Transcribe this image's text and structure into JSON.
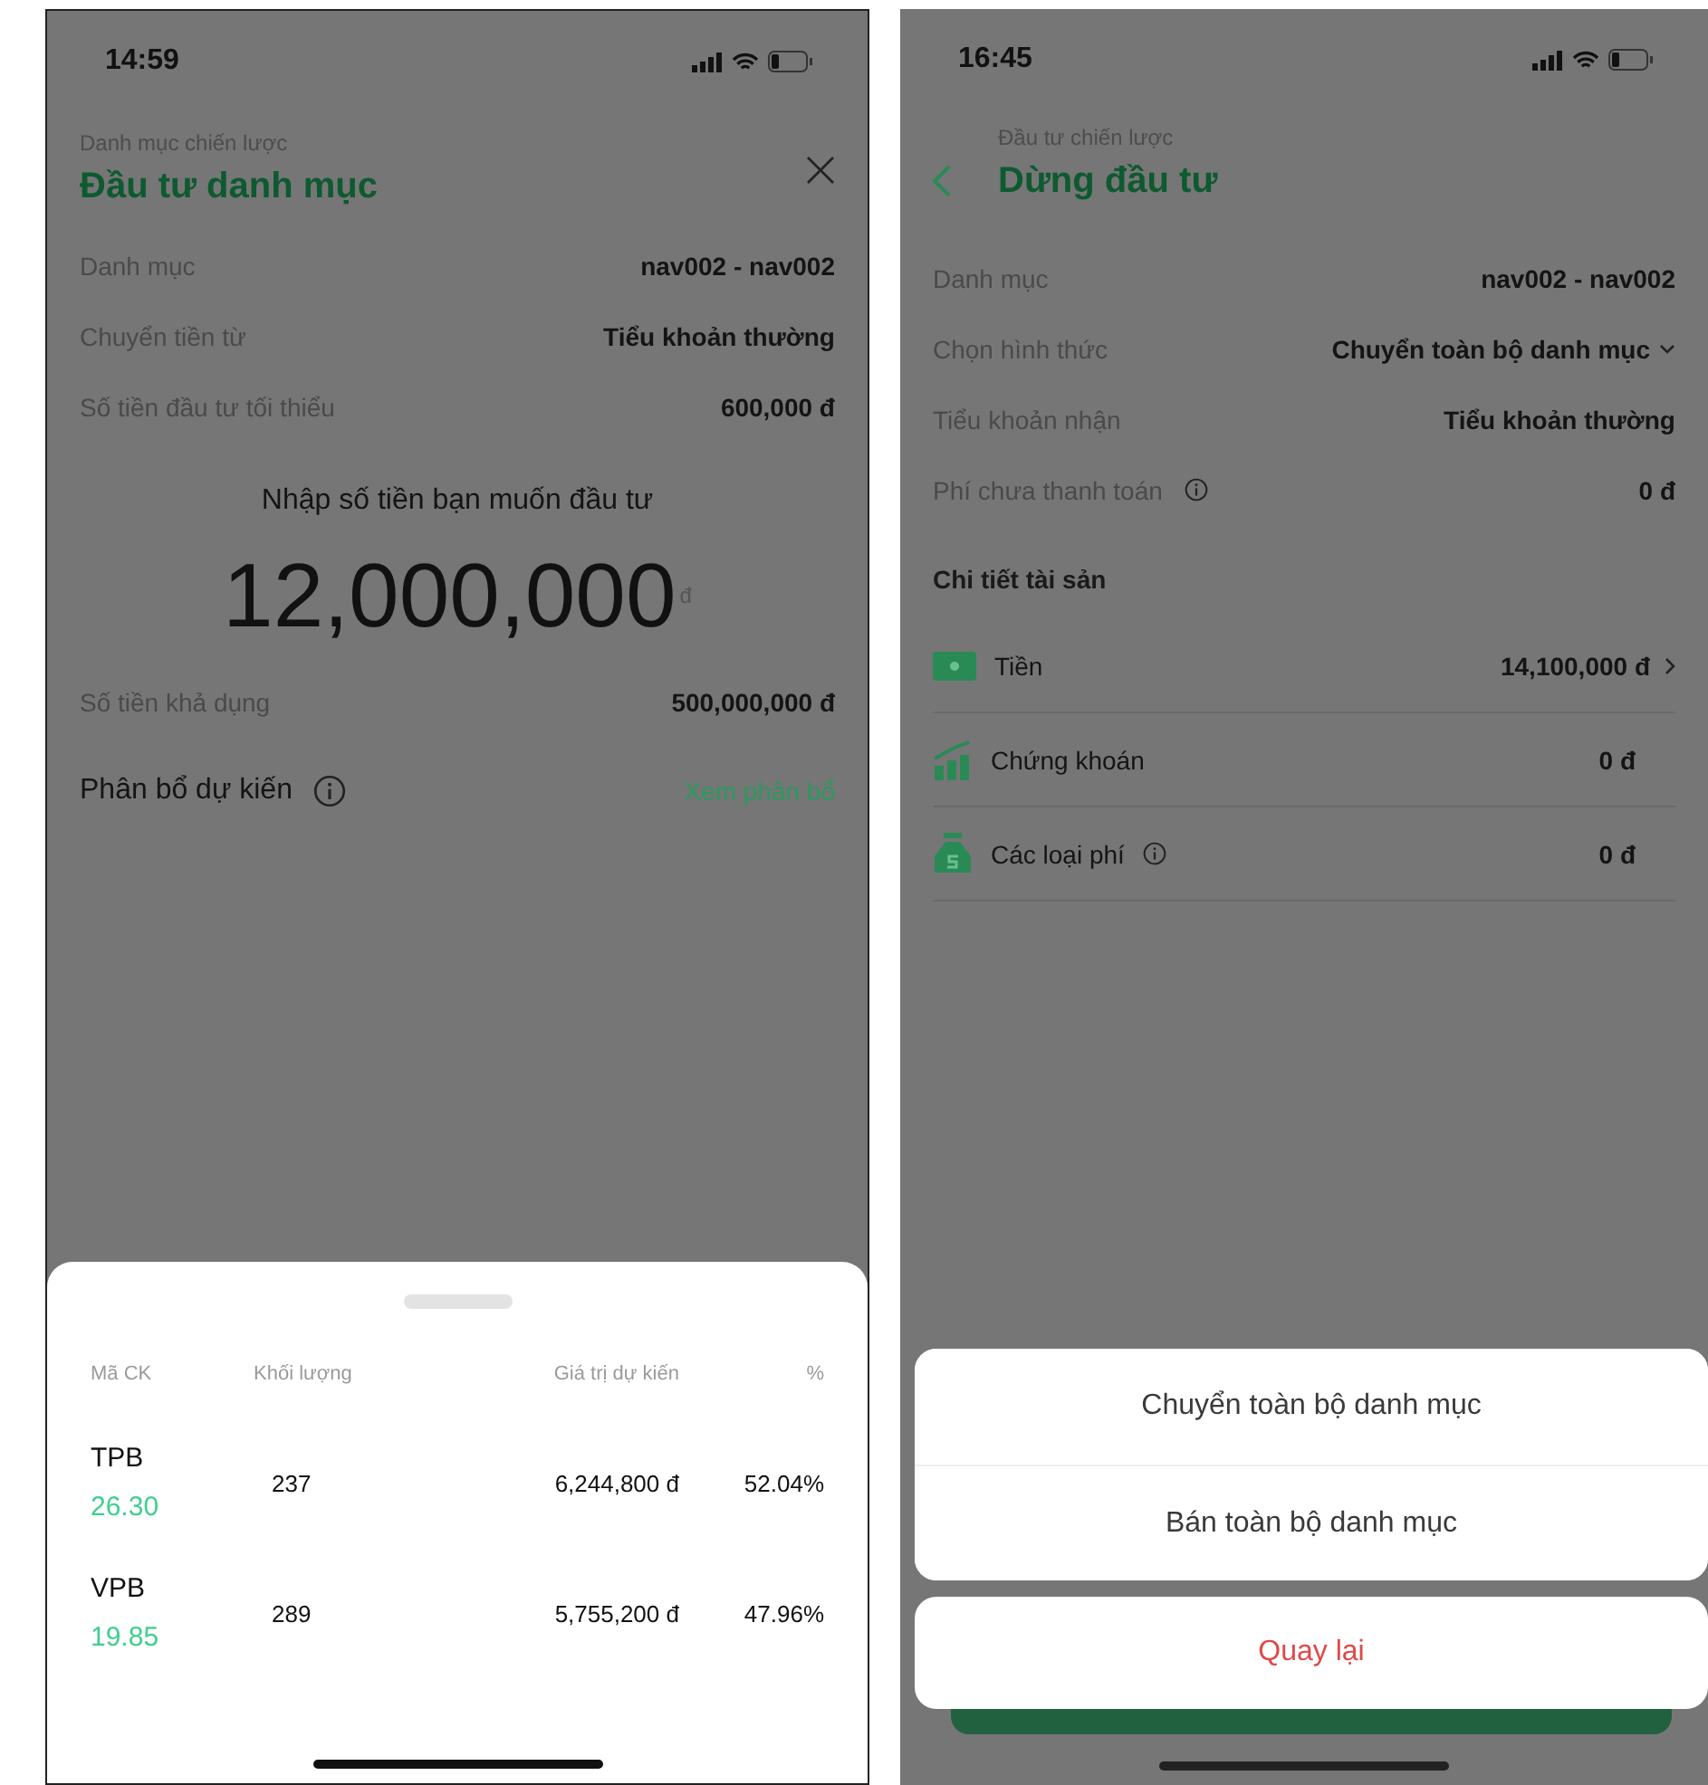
{
  "invest_screen": {
    "status_bar": {
      "time": "14:59"
    },
    "header": {
      "breadcrumb": "Danh mục chiến lược",
      "title": "Đầu tư danh mục"
    },
    "info_rows": [
      {
        "label": "Danh mục",
        "value": "nav002 - nav002"
      },
      {
        "label": "Chuyển tiền từ",
        "value": "Tiểu khoản thường"
      },
      {
        "label": "Số tiền đầu tư tối thiểu",
        "value": "600,000 đ"
      }
    ],
    "amount_prompt": "Nhập số tiền bạn muốn đầu tư",
    "amount": {
      "value": "12,000,000",
      "currency": "đ"
    },
    "available": {
      "label": "Số tiền khả dụng",
      "value": "500,000,000 đ"
    },
    "allocation": {
      "label": "Phân bổ dự kiến",
      "link": "Xem phân bổ"
    },
    "allocation_sheet": {
      "columns": [
        "Mã CK",
        "Khối lượng",
        "Giá trị dự kiến",
        "%"
      ],
      "rows": [
        {
          "code": "TPB",
          "price": "26.30",
          "volume": "237",
          "value": "6,244,800 đ",
          "percent": "52.04%"
        },
        {
          "code": "VPB",
          "price": "19.85",
          "volume": "289",
          "value": "5,755,200 đ",
          "percent": "47.96%"
        }
      ]
    }
  },
  "stop_screen": {
    "status_bar": {
      "time": "16:45"
    },
    "header": {
      "breadcrumb": "Đầu tư chiến lược",
      "title": "Dừng đầu tư"
    },
    "info_rows": [
      {
        "kind": "text",
        "label": "Danh mục",
        "value": "nav002 - nav002"
      },
      {
        "kind": "dropdown",
        "label": "Chọn hình thức",
        "value": "Chuyển toàn bộ danh mục"
      },
      {
        "kind": "text",
        "label": "Tiểu khoản nhận",
        "value": "Tiểu khoản thường"
      },
      {
        "kind": "info",
        "label": "Phí chưa thanh toán",
        "value": "0 đ"
      }
    ],
    "section_title": "Chi tiết tài sản",
    "assets": [
      {
        "kind": "cash",
        "label": "Tiền",
        "value": "14,100,000 đ",
        "info": false,
        "chevron": true
      },
      {
        "kind": "stocks",
        "label": "Chứng khoán",
        "value": "0 đ",
        "info": false,
        "chevron": false
      },
      {
        "kind": "fees",
        "label": "Các loại phí",
        "value": "0 đ",
        "info": true,
        "chevron": false
      }
    ],
    "action_sheet": {
      "options": [
        "Chuyển toàn bộ danh mục",
        "Bán toàn bộ danh mục"
      ],
      "cancel": "Quay lại"
    }
  }
}
